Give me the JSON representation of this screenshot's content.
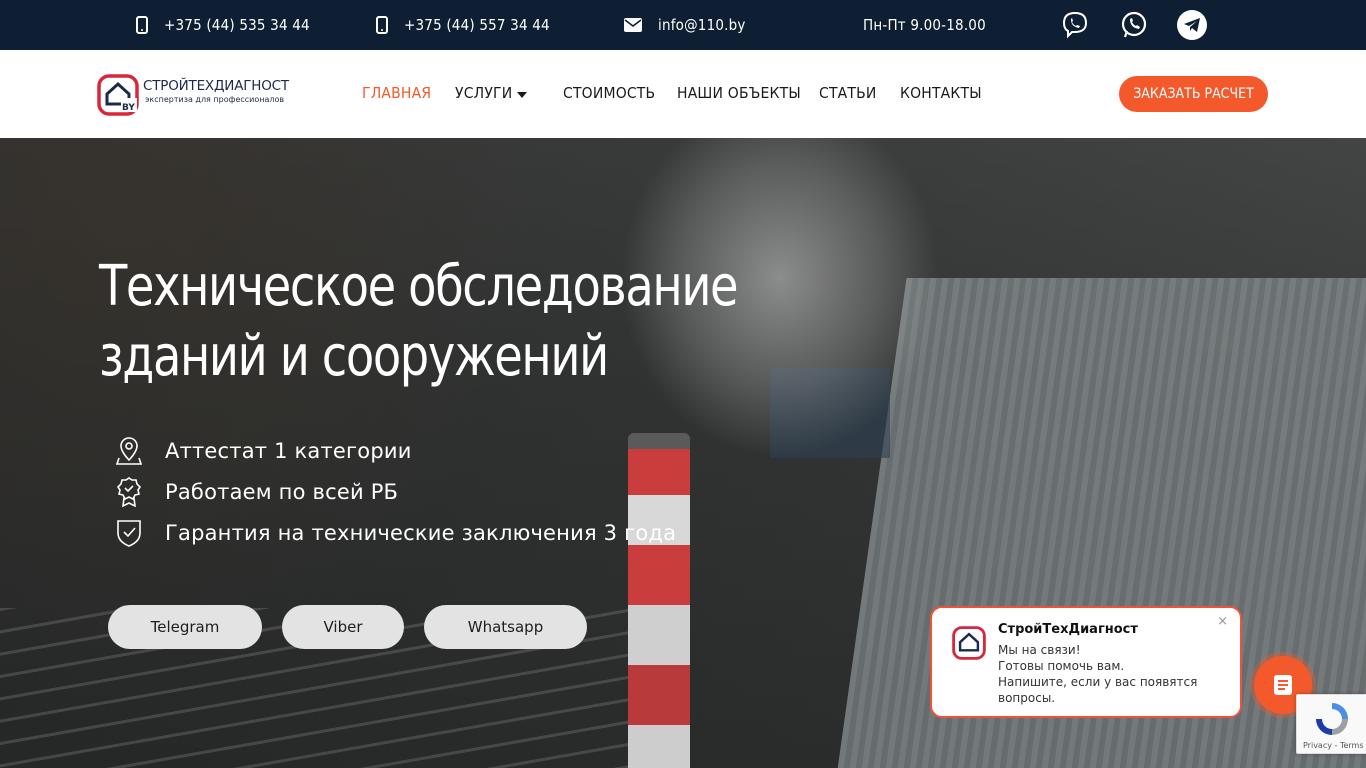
{
  "topbar": {
    "phone1": "+375 (44) 535 34 44",
    "phone2": "+375 (44) 557 34 44",
    "email": "info@110.by",
    "hours": "Пн-Пт 9.00-18.00",
    "social": [
      "viber-icon",
      "whatsapp-icon",
      "telegram-icon"
    ]
  },
  "header": {
    "logo_name": "СТРОЙТЕХДИАГНОСТ",
    "logo_tagline": "экспертиза для профессионалов",
    "logo_badge": "BY",
    "nav": [
      "ГЛАВНАЯ",
      "УСЛУГИ",
      "СТОИМОСТЬ",
      "НАШИ ОБЪЕКТЫ",
      "СТАТЬИ",
      "КОНТАКТЫ"
    ],
    "active_nav": "ГЛАВНАЯ",
    "cta": "ЗАКАЗАТЬ РАСЧЕТ"
  },
  "hero": {
    "title_line1": "Техническое обследование",
    "title_line2": "зданий и сооружений",
    "features": [
      "Аттестат 1 категории",
      "Работаем по всей РБ",
      "Гарантия на технические заключения 3 года"
    ],
    "buttons": [
      "Telegram",
      "Viber",
      "Whatsapp"
    ]
  },
  "chat": {
    "name": "СтройТехДиагност",
    "lines": [
      "Мы на связи!",
      "Готовы помочь вам.",
      "Напишите, если у вас появятся",
      "вопросы."
    ],
    "close": "×"
  },
  "recaptcha": {
    "text": "Privacy - Terms"
  },
  "colors": {
    "accent": "#f4592b",
    "topbar": "#0f1f33",
    "logo_red": "#d8263b",
    "logo_navy": "#1b2a4a"
  }
}
